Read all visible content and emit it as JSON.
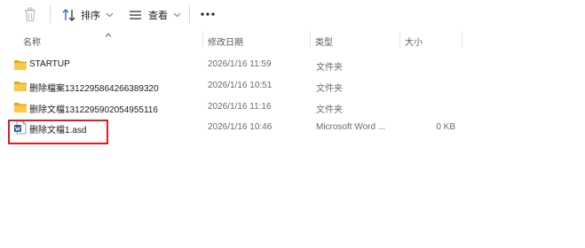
{
  "toolbar": {
    "delete_icon": "trash-icon",
    "sort_label": "排序",
    "view_label": "查看",
    "more_icon": "more-icon"
  },
  "columns": {
    "name": "名称",
    "modified": "修改日期",
    "type": "类型",
    "size": "大小"
  },
  "rows": [
    {
      "icon": "folder-icon",
      "name": "STARTUP",
      "modified": "2026/1/16 11:59",
      "type": "文件夹",
      "size": ""
    },
    {
      "icon": "folder-icon",
      "name": "删除檔案1312295864266389320",
      "modified": "2026/1/16 10:51",
      "type": "文件夹",
      "size": ""
    },
    {
      "icon": "folder-icon",
      "name": "删除文檔1312295902054955116",
      "modified": "2026/1/16 11:16",
      "type": "文件夹",
      "size": ""
    },
    {
      "icon": "word-doc-icon",
      "name": "删除文檔1.asd",
      "modified": "2026/1/16 10:46",
      "type": "Microsoft Word ...",
      "size": "0 KB"
    }
  ],
  "colors": {
    "folder": "#f7c948",
    "highlight": "#e01b22",
    "word_blue": "#2b579a"
  }
}
